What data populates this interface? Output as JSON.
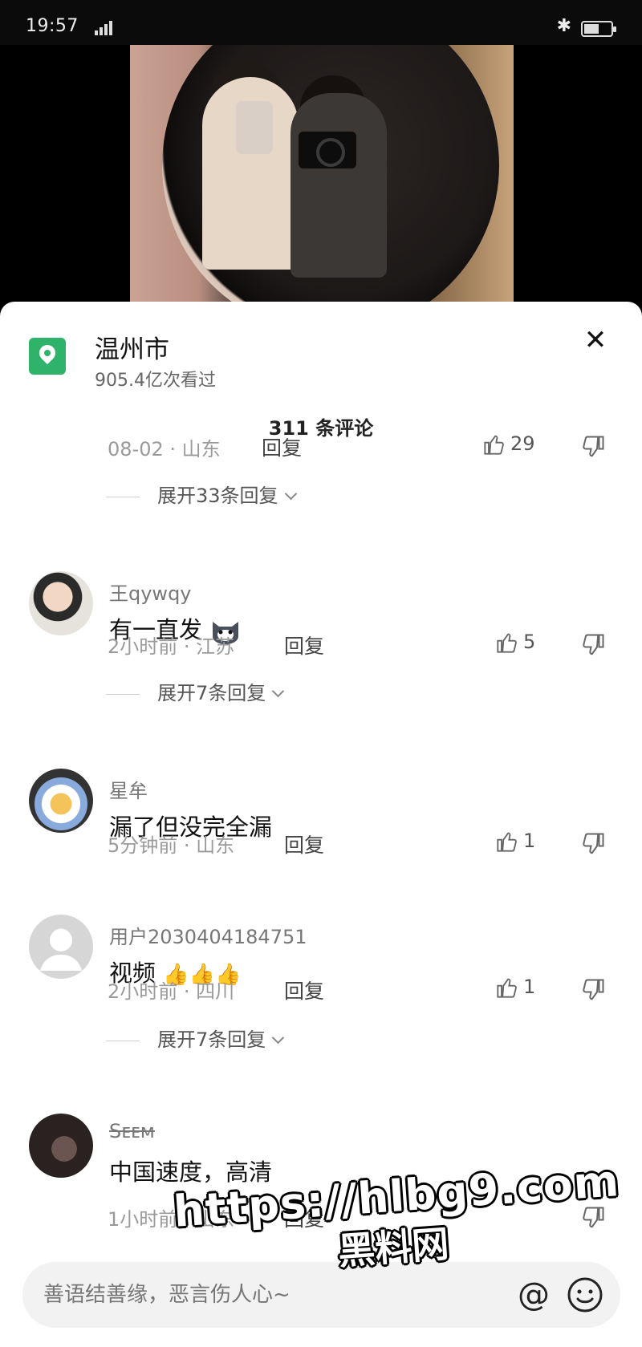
{
  "status": {
    "time": "19:57"
  },
  "sheet": {
    "location": {
      "title": "温州市",
      "views": "905.4亿次看过"
    },
    "comment_count": "311 条评论",
    "first": {
      "meta": "08-02 · 山东",
      "reply": "回复",
      "likes": "29",
      "expand": "展开33条回复"
    },
    "comments": [
      {
        "user": "王qywqy",
        "text": "有一直发",
        "meta": "2小时前 · 江苏",
        "reply": "回复",
        "likes": "5",
        "expand": "展开7条回复"
      },
      {
        "user": "星牟",
        "text": "漏了但没完全漏",
        "meta": "5分钟前 · 山东",
        "reply": "回复",
        "likes": "1"
      },
      {
        "user": "用户2030404184751",
        "text": "视频",
        "meta": "2小时前 · 四川",
        "reply": "回复",
        "likes": "1",
        "expand": "展开7条回复"
      },
      {
        "user": "Sᴇᴇᴍ",
        "text": "中国速度，高清",
        "meta": "1小时前 · 山东",
        "reply": "回复"
      }
    ]
  },
  "input": {
    "placeholder": "善语结善缘，恶言伤人心~",
    "at": "@"
  },
  "watermark": {
    "url": "https://hlbg9.com",
    "name": "黑料网"
  }
}
